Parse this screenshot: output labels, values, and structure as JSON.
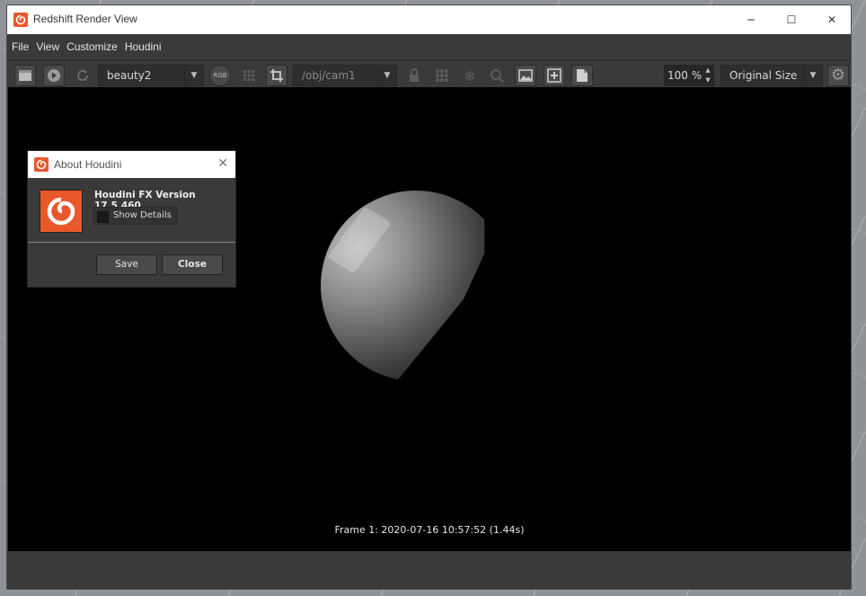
{
  "window": {
    "title": "Redshift Render View",
    "controls": {
      "minimize": "─",
      "maximize": "☐",
      "close": "✕"
    }
  },
  "menu": [
    "File",
    "View",
    "Customize",
    "Houdini"
  ],
  "toolbar": {
    "aov_value": "beauty2",
    "rgb_label": "RGB",
    "camera_value": "/obj/cam1",
    "zoom_value": "100 %",
    "size_value": "Original Size"
  },
  "viewport": {
    "frame_info": "Frame  1:  2020-07-16  10:57:52  (1.44s)"
  },
  "dialog": {
    "title": "About Houdini",
    "version": "Houdini FX Version 17.5.460",
    "show_details_label": "Show Details",
    "show_details_checked": false,
    "save_label": "Save",
    "close_label": "Close"
  },
  "colors": {
    "brand": "#e8582a",
    "bg": "#3a3a3a",
    "viewport": "#000000"
  },
  "icons": [
    "houdini-logo-icon",
    "render-clapper-icon",
    "play-icon",
    "refresh-icon",
    "rgb-channel-icon",
    "grid-icon",
    "crop-icon",
    "lock-icon",
    "tiles-icon",
    "snowflake-icon",
    "search-icon",
    "image-icon",
    "add-icon",
    "document-icon",
    "gear-icon"
  ]
}
